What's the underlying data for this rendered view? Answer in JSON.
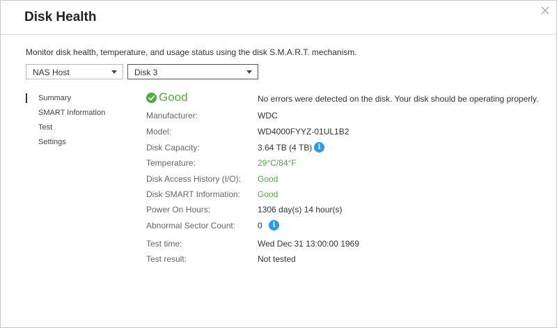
{
  "dialog": {
    "title": "Disk Health",
    "description": "Monitor disk health, temperature, and usage status using the disk S.M.A.R.T. mechanism."
  },
  "selectors": {
    "host": "NAS Host",
    "disk": "Disk 3"
  },
  "nav": {
    "items": [
      {
        "label": "Summary"
      },
      {
        "label": "SMART Information"
      },
      {
        "label": "Test"
      },
      {
        "label": "Settings"
      }
    ]
  },
  "summary": {
    "status": "Good",
    "status_message": "No errors were detected on the disk. Your disk should be operating properly.",
    "fields": {
      "manufacturer": {
        "label": "Manufacturer:",
        "value": "WDC"
      },
      "model": {
        "label": "Model:",
        "value": "WD4000FYYZ-01UL1B2"
      },
      "capacity": {
        "label": "Disk Capacity:",
        "value": "3.64 TB (4 TB)"
      },
      "temperature": {
        "label": "Temperature:",
        "value": "29°C/84°F"
      },
      "access_history": {
        "label": "Disk Access History (I/O):",
        "value": "Good"
      },
      "smart_info": {
        "label": "Disk SMART Information:",
        "value": "Good"
      },
      "power_on_hours": {
        "label": "Power On Hours:",
        "value": "1306 day(s) 14 hour(s)"
      },
      "abnormal_sectors": {
        "label": "Abnormal Sector Count:",
        "value": "0"
      },
      "test_time": {
        "label": "Test time:",
        "value": "Wed Dec 31 13:00:00 1969"
      },
      "test_result": {
        "label": "Test result:",
        "value": "Not tested"
      }
    }
  },
  "colors": {
    "good": "#4caf3b",
    "info": "#2a9be6"
  },
  "icons": {
    "status": "check-circle-icon",
    "info": "info-icon",
    "close": "close-icon"
  }
}
